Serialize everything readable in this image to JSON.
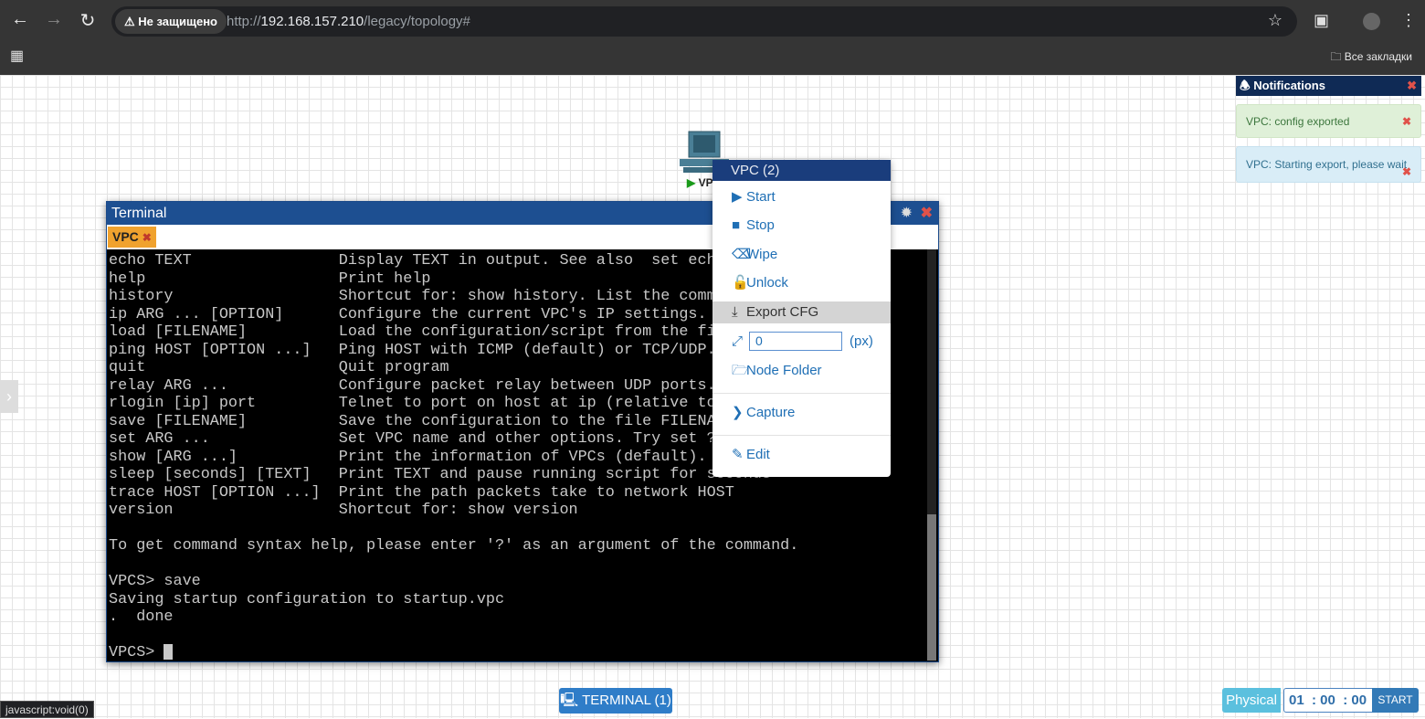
{
  "browser": {
    "security": "Не защищено",
    "url_prefix": "http://",
    "url_host": "192.168.157.210",
    "url_path": "/legacy/topology#",
    "bookmarks": "Все закладки",
    "status_bar": "javascript:void(0)"
  },
  "node": {
    "label": "VP"
  },
  "terminal": {
    "title": "Terminal",
    "tab": "VPC",
    "lines": [
      "echo TEXT                Display TEXT in output. See also  set echo ?",
      "help                     Print help",
      "history                  Shortcut for: show history. List the command",
      "ip ARG ... [OPTION]      Configure the current VPC's IP settings. See",
      "load [FILENAME]          Load the configuration/script from the file",
      "ping HOST [OPTION ...]   Ping HOST with ICMP (default) or TCP/UDP. Se",
      "quit                     Quit program",
      "relay ARG ...            Configure packet relay between UDP ports. Se",
      "rlogin [ip] port         Telnet to port on host at ip (relative to ho",
      "save [FILENAME]          Save the configuration to the file FILENAME",
      "set ARG ...              Set VPC name and other options. Try set ?",
      "show [ARG ...]           Print the information of VPCs (default). Se",
      "sleep [seconds] [TEXT]   Print TEXT and pause running script for seconds",
      "trace HOST [OPTION ...]  Print the path packets take to network HOST",
      "version                  Shortcut for: show version",
      "",
      "To get command syntax help, please enter '?' as an argument of the command.",
      "",
      "VPCS> save",
      "Saving startup configuration to startup.vpc",
      ".  done",
      "",
      "VPCS> "
    ]
  },
  "context_menu": {
    "title": "VPC (2)",
    "items": {
      "start": "Start",
      "stop": "Stop",
      "wipe": "Wipe",
      "unlock": "Unlock",
      "export": "Export CFG",
      "resize_value": "0",
      "resize_unit": "(px)",
      "folder": "Node Folder",
      "capture": "Capture",
      "edit": "Edit"
    }
  },
  "notifications": {
    "title": "Notifications",
    "items": [
      "VPC: config exported",
      "VPC: Starting export, please wait"
    ]
  },
  "footer": {
    "terminal_button": "TERMINAL (1)",
    "mode": "Physical",
    "timer": "01  : 00  : 00",
    "start": "START"
  }
}
